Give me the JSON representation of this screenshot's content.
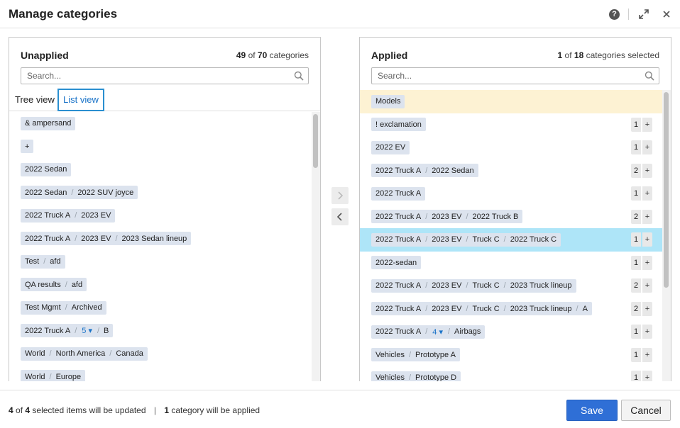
{
  "dialog": {
    "title": "Manage categories",
    "help_glyph": "?",
    "icons": [
      "help-icon",
      "expand-icon",
      "close-icon"
    ]
  },
  "unapplied": {
    "title": "Unapplied",
    "count_current": "49",
    "count_of": "of",
    "count_total": "70",
    "count_suffix": "categories",
    "search_placeholder": "Search...",
    "tab_tree": "Tree view",
    "tab_list": "List view",
    "items": [
      [
        "& ampersand"
      ],
      [
        "+"
      ],
      [
        "2022 Sedan"
      ],
      [
        "2022 Sedan",
        "2022 SUV joyce"
      ],
      [
        "2022 Truck A",
        "2023 EV"
      ],
      [
        "2022 Truck A",
        "2023 EV",
        "2023 Sedan lineup"
      ],
      [
        "Test",
        "afd"
      ],
      [
        "QA results",
        "afd"
      ],
      [
        "Test Mgmt",
        "Archived"
      ],
      [
        "2022 Truck A",
        "5 ▾",
        "B"
      ],
      [
        "World",
        "North America",
        "Canada"
      ],
      [
        "World",
        "Europe"
      ]
    ]
  },
  "applied": {
    "title": "Applied",
    "count_current": "1",
    "count_of": "of",
    "count_total": "18",
    "count_suffix": "categories selected",
    "search_placeholder": "Search...",
    "items": [
      {
        "parts": [
          "Models"
        ],
        "count": "",
        "highlight": "yellow"
      },
      {
        "parts": [
          "! exclamation"
        ],
        "count": "1",
        "highlight": ""
      },
      {
        "parts": [
          "2022 EV"
        ],
        "count": "1",
        "highlight": ""
      },
      {
        "parts": [
          "2022 Truck A",
          "2022 Sedan"
        ],
        "count": "2",
        "highlight": ""
      },
      {
        "parts": [
          "2022 Truck A"
        ],
        "count": "1",
        "highlight": ""
      },
      {
        "parts": [
          "2022 Truck A",
          "2023 EV",
          "2022 Truck B"
        ],
        "count": "2",
        "highlight": ""
      },
      {
        "parts": [
          "2022 Truck A",
          "2023 EV",
          "Truck C",
          "2022 Truck C"
        ],
        "count": "1",
        "highlight": "blue"
      },
      {
        "parts": [
          "2022-sedan"
        ],
        "count": "1",
        "highlight": ""
      },
      {
        "parts": [
          "2022 Truck A",
          "2023 EV",
          "Truck C",
          "2023 Truck lineup"
        ],
        "count": "2",
        "highlight": ""
      },
      {
        "parts": [
          "2022 Truck A",
          "2023 EV",
          "Truck C",
          "2023 Truck lineup",
          "A"
        ],
        "count": "2",
        "highlight": ""
      },
      {
        "parts": [
          "2022 Truck A",
          "4 ▾",
          "Airbags"
        ],
        "count": "1",
        "highlight": ""
      },
      {
        "parts": [
          "Vehicles",
          "Prototype A"
        ],
        "count": "1",
        "highlight": ""
      },
      {
        "parts": [
          "Vehicles",
          "Prototype D"
        ],
        "count": "1",
        "highlight": ""
      }
    ]
  },
  "move": {
    "right_icon": "chevron-right-icon",
    "left_icon": "chevron-left-icon"
  },
  "footer": {
    "selected_count": "4",
    "of_text": "of",
    "selected_total": "4",
    "selected_suffix": "selected items will be updated",
    "separator": "|",
    "applied_count": "1",
    "applied_suffix": "category will be applied",
    "save_label": "Save",
    "cancel_label": "Cancel"
  },
  "colors": {
    "accent": "#2f6fd6",
    "link": "#1a73c8",
    "chip_bg": "#dce3ee",
    "row_highlight_yellow": "#fdf2d3",
    "row_highlight_blue": "#aee5f8"
  }
}
